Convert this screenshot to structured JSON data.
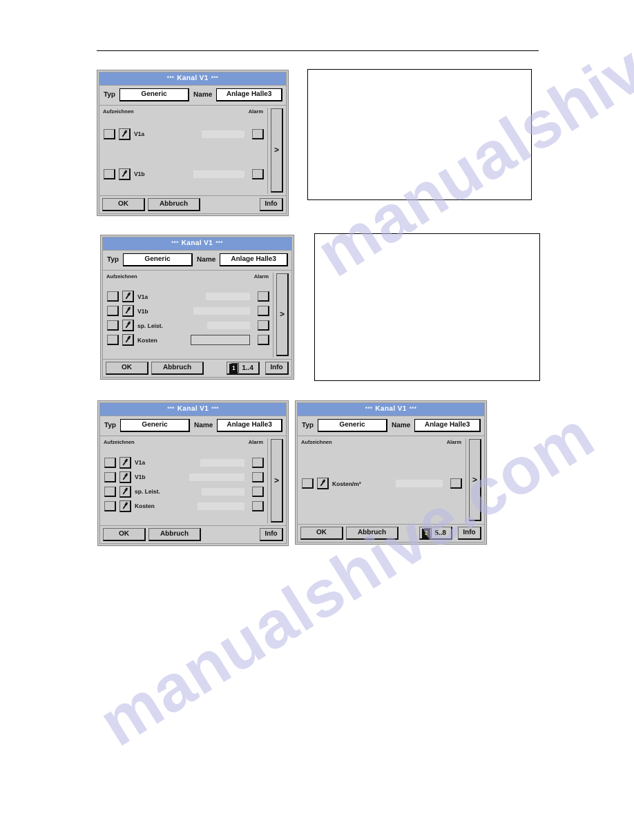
{
  "page": {
    "watermark": "manualshive.com",
    "rule": "horizontal-rule"
  },
  "common": {
    "title_text": "Kanal V1",
    "title_stars": "***",
    "typ_label": "Typ",
    "typ_value": "Generic",
    "name_label": "Name",
    "name_value": "Anlage Halle3",
    "col_record": "Aufzeichnen",
    "col_alarm": "Alarm",
    "ok_label": "OK",
    "cancel_label": "Abbruch",
    "info_label": "Info",
    "next_label": ">"
  },
  "dialogs": [
    {
      "id": "dialog-1-two-channels",
      "rows": [
        {
          "label": "V1a"
        },
        {
          "label": "V1b"
        }
      ],
      "pager": null
    },
    {
      "id": "dialog-2-four-channels-page1",
      "rows": [
        {
          "label": "V1a"
        },
        {
          "label": "V1b"
        },
        {
          "label": "sp. Leist."
        },
        {
          "label": "Kosten"
        }
      ],
      "pager": {
        "number": "1",
        "range": "1..4",
        "number_color": "#ffffff"
      }
    },
    {
      "id": "dialog-3-four-channels",
      "rows": [
        {
          "label": "V1a"
        },
        {
          "label": "V1b"
        },
        {
          "label": "sp. Leist."
        },
        {
          "label": "Kosten"
        }
      ],
      "pager": null
    },
    {
      "id": "dialog-4-cost-per-m3-page2",
      "rows": [
        {
          "label": "Kosten/m³"
        }
      ],
      "pager": {
        "number": "2",
        "range": "5..8",
        "number_color": "#f6e800"
      }
    }
  ],
  "placeholders": [
    {
      "id": "blank-box-top-right"
    },
    {
      "id": "blank-box-middle-right"
    }
  ],
  "colors": {
    "titlebar": "#7a9ad6",
    "dialog_face": "#cfcfcf",
    "field_white": "#ffffff",
    "value_field": "#dcdcdc",
    "watermark": "#b9b9e6"
  }
}
